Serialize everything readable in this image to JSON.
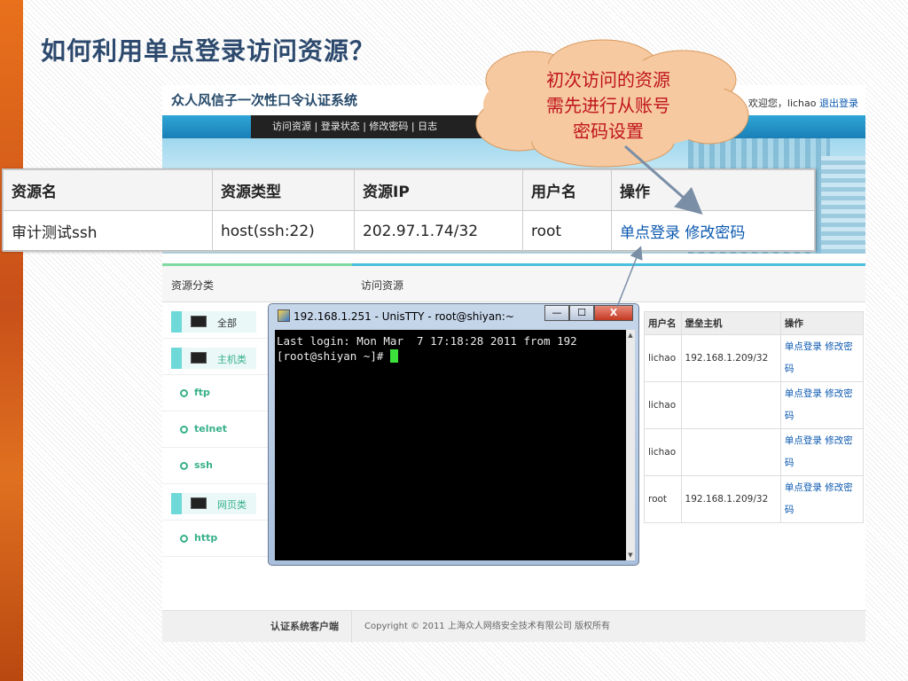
{
  "slide": {
    "title": "如何利用单点登录访问资源？"
  },
  "callout": {
    "line1": "初次访问的资源",
    "line2": "需先进行从账号",
    "line3": "密码设置"
  },
  "site": {
    "name": "众人风信子一次性口令认证系统",
    "welcome": "欢迎您，lichao",
    "logout": "退出登录",
    "nav": "访问资源 | 登录状态 | 修改密码 | 日志"
  },
  "sections": {
    "categories": "资源分类",
    "access": "访问资源"
  },
  "categories": [
    {
      "label": "全部",
      "kind": "monitor"
    },
    {
      "label": "主机类",
      "kind": "monitor"
    },
    {
      "label": "ftp",
      "kind": "sub"
    },
    {
      "label": "telnet",
      "kind": "sub"
    },
    {
      "label": "ssh",
      "kind": "sub"
    },
    {
      "label": "网页类",
      "kind": "monitor"
    },
    {
      "label": "http",
      "kind": "sub"
    }
  ],
  "resource_table": {
    "headers": [
      "用户名",
      "堡垒主机",
      "操作"
    ],
    "rows": [
      {
        "user": "lichao",
        "host": "192.168.1.209/32",
        "op1": "单点登录 修改密",
        "op2": "码"
      },
      {
        "user": "lichao",
        "host": "",
        "op1": "单点登录 修改密",
        "op2": "码"
      },
      {
        "user": "lichao",
        "host": "",
        "op1": "单点登录 修改密",
        "op2": "码"
      },
      {
        "user": "root",
        "host": "192.168.1.209/32",
        "op1": "单点登录 修改密",
        "op2": "码"
      }
    ]
  },
  "footer": {
    "left": "认证系统客户端",
    "copyright": "Copyright © 2011 上海众人网络安全技术有限公司 版权所有"
  },
  "zoom_table": {
    "headers": [
      "资源名",
      "资源类型",
      "资源IP",
      "用户名",
      "操作"
    ],
    "row": {
      "name": "审计测试ssh",
      "type": "host(ssh:22)",
      "ip": "202.97.1.74/32",
      "user": "root",
      "sso": "单点登录",
      "chpw": "修改密码"
    }
  },
  "terminal": {
    "title": "192.168.1.251 - UnisTTY - root@shiyan:~",
    "line1": "Last login: Mon Mar  7 17:18:28 2011 from 192",
    "prompt": "[root@shiyan ~]# ",
    "buttons": {
      "minimize": "—",
      "maximize": "☐",
      "close": "X"
    }
  },
  "colors": {
    "accent_orange": "#e8711c",
    "title_blue": "#2d4a6e",
    "callout_red": "#c0141c",
    "link_blue": "#0a58b0",
    "cloud_fill": "#f6c9a0"
  }
}
